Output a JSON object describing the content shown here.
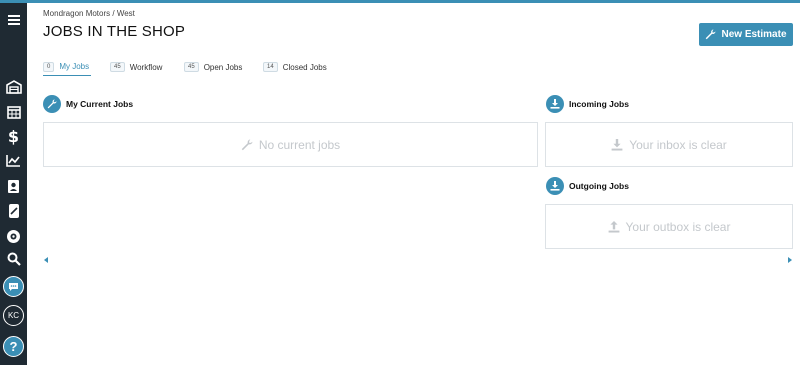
{
  "breadcrumb": "Mondragon Motors / West",
  "page_title": "JOBS IN THE SHOP",
  "new_estimate_label": "New Estimate",
  "tabs": [
    {
      "count": "0",
      "label": "My Jobs",
      "active": true
    },
    {
      "count": "45",
      "label": "Workflow"
    },
    {
      "count": "45",
      "label": "Open Jobs"
    },
    {
      "count": "14",
      "label": "Closed Jobs"
    }
  ],
  "sections": {
    "current": {
      "title": "My Current Jobs",
      "empty": "No current jobs",
      "icon": "wrench-icon"
    },
    "incoming": {
      "title": "Incoming Jobs",
      "empty": "Your inbox is clear",
      "icon": "download-icon"
    },
    "outgoing": {
      "title": "Outgoing Jobs",
      "empty": "Your outbox is clear",
      "icon": "download-icon"
    }
  },
  "sidebar": {
    "items": [
      "menu-icon",
      "garage-icon",
      "calendar-icon",
      "dollar-icon",
      "chart-icon",
      "contacts-icon",
      "parts-icon",
      "tire-icon",
      "search-icon",
      "chat-icon"
    ],
    "user_initials": "KC",
    "help_label": "?"
  },
  "colors": {
    "accent": "#3b8fb5",
    "sidebar": "#1f2a33",
    "empty_text": "#c4c8cc"
  }
}
